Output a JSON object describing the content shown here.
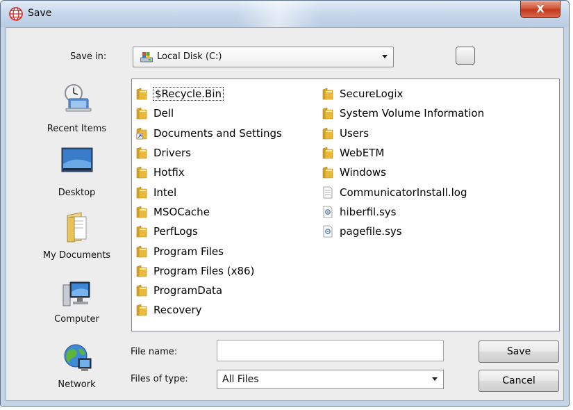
{
  "window": {
    "title": "Save",
    "close_glyph": "X"
  },
  "save_in": {
    "label": "Save in:",
    "value": "Local Disk (C:)"
  },
  "places": [
    {
      "label": "Recent Items",
      "icon": "recent-items-icon"
    },
    {
      "label": "Desktop",
      "icon": "desktop-icon"
    },
    {
      "label": "My Documents",
      "icon": "my-documents-icon"
    },
    {
      "label": "Computer",
      "icon": "computer-icon"
    },
    {
      "label": "Network",
      "icon": "network-icon"
    }
  ],
  "files": {
    "column1": [
      {
        "name": "$Recycle.Bin",
        "type": "folder",
        "selected": true
      },
      {
        "name": "Dell",
        "type": "folder"
      },
      {
        "name": "Documents and Settings",
        "type": "shortcut-folder"
      },
      {
        "name": "Drivers",
        "type": "folder"
      },
      {
        "name": "Hotfix",
        "type": "folder"
      },
      {
        "name": "Intel",
        "type": "folder"
      },
      {
        "name": "MSOCache",
        "type": "folder"
      },
      {
        "name": "PerfLogs",
        "type": "folder"
      },
      {
        "name": "Program Files",
        "type": "folder"
      },
      {
        "name": "Program Files (x86)",
        "type": "folder"
      },
      {
        "name": "ProgramData",
        "type": "folder"
      },
      {
        "name": "Recovery",
        "type": "folder"
      }
    ],
    "column2": [
      {
        "name": "SecureLogix",
        "type": "folder"
      },
      {
        "name": "System Volume Information",
        "type": "folder"
      },
      {
        "name": "Users",
        "type": "folder"
      },
      {
        "name": "WebETM",
        "type": "folder"
      },
      {
        "name": "Windows",
        "type": "folder"
      },
      {
        "name": "CommunicatorInstall.log",
        "type": "text-file"
      },
      {
        "name": "hiberfil.sys",
        "type": "system-file"
      },
      {
        "name": "pagefile.sys",
        "type": "system-file"
      }
    ]
  },
  "file_name": {
    "label": "File name:",
    "value": ""
  },
  "file_type": {
    "label": "Files of type:",
    "value": "All Files"
  },
  "buttons": {
    "save": "Save",
    "cancel": "Cancel"
  },
  "colors": {
    "folder": "#e8b93c",
    "close_button": "#c8452a",
    "title_bar": "#c9d9ec"
  }
}
